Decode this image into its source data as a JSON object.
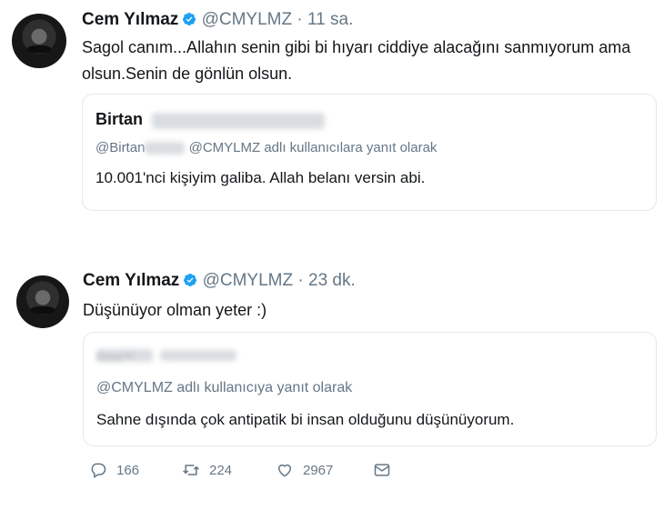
{
  "tweets": [
    {
      "name": "Cem Yılmaz",
      "handle": "@CMYLMZ",
      "separator": "·",
      "time": "11 sa.",
      "text": "Sagol canım...Allahın senin gibi bi hıyarı ciddiye alacağını sanmıyorum ama olsun.Senin de gönlün olsun.",
      "quote": {
        "name": "Birtan",
        "handle_prefix": "@Birtan",
        "reply": "@CMYLMZ adlı kullanıcılara yanıt olarak",
        "text": "10.001'nci kişiyim galiba. Allah belanı versin abi."
      }
    },
    {
      "name": "Cem Yılmaz",
      "handle": "@CMYLMZ",
      "separator": "·",
      "time": "23 dk.",
      "text": "Düşünüyor olman yeter :)",
      "quote": {
        "name": "Emre™",
        "reply": "@CMYLMZ adlı kullanıcıya yanıt olarak",
        "text": "Sahne dışında çok antipatik bi insan olduğunu düşünüyorum."
      },
      "actions": {
        "replies": "166",
        "retweets": "224",
        "likes": "2967"
      }
    }
  ],
  "colors": {
    "verified": "#1da1f2",
    "muted": "#657786",
    "border": "#e1e8ed"
  }
}
